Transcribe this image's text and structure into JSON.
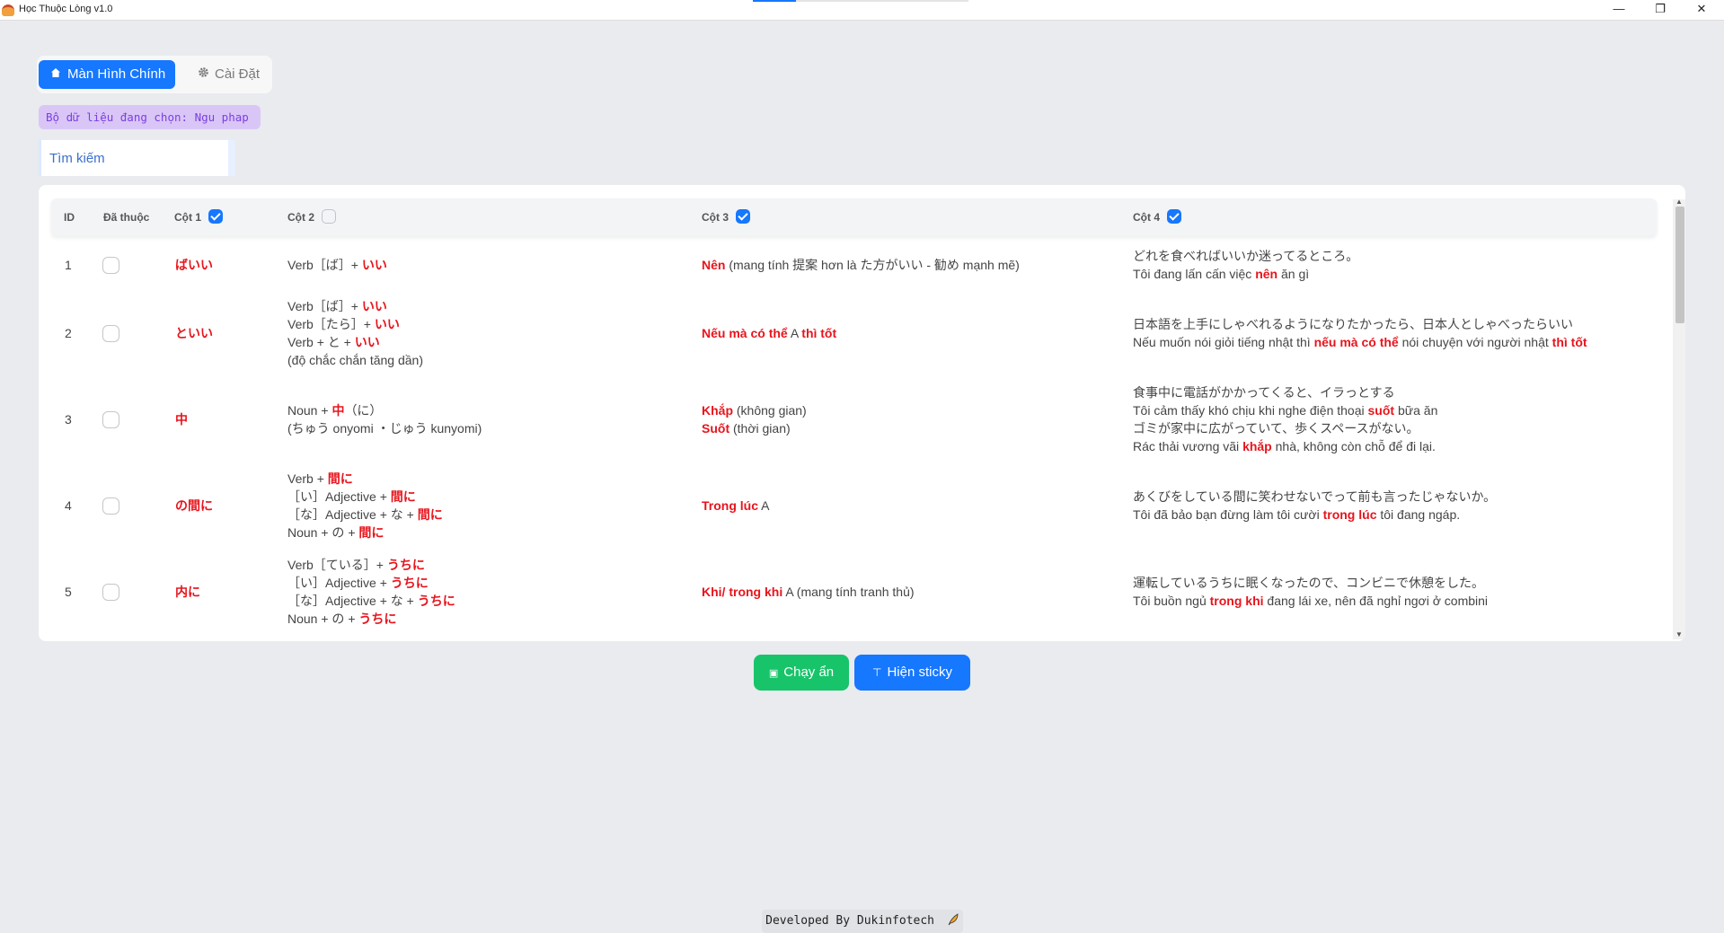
{
  "window": {
    "title": "Học Thuộc Lòng v1.0",
    "minimize": "—",
    "maximize": "❐",
    "close": "✕"
  },
  "tabs": [
    {
      "label": "Màn Hình Chính",
      "icon": "home-icon",
      "active": true
    },
    {
      "label": "Cài Đặt",
      "icon": "gear-icon",
      "active": false
    }
  ],
  "dataset_label": "Bộ dữ liệu đang chọn: Ngu phap",
  "search": {
    "placeholder": "Tìm kiếm",
    "value": ""
  },
  "table": {
    "headers": {
      "id": "ID",
      "learned": "Đã thuộc",
      "col1": "Cột 1",
      "col2": "Cột 2",
      "col3": "Cột 3",
      "col4": "Cột 4"
    },
    "header_checks": {
      "col1": true,
      "col2": false,
      "col3": true,
      "col4": true
    },
    "rows": [
      {
        "id": "1",
        "learned": false,
        "col1": "ばいい",
        "col2": [
          [
            {
              "t": "Verb［ば］+ ",
              "hl": false
            },
            {
              "t": "いい",
              "hl": true
            }
          ]
        ],
        "col3": [
          [
            {
              "t": "Nên",
              "hl": true
            },
            {
              "t": " (mang tính 提案 hơn là た方がいい - 勧め mạnh mẽ)",
              "hl": false
            }
          ]
        ],
        "col4": [
          [
            {
              "t": "どれを食べればいいか迷ってるところ。",
              "hl": false
            }
          ],
          [
            {
              "t": "Tôi đang lấn cấn việc ",
              "hl": false
            },
            {
              "t": "nên",
              "hl": true
            },
            {
              "t": " ăn gì",
              "hl": false
            }
          ]
        ]
      },
      {
        "id": "2",
        "learned": false,
        "col1": "といい",
        "col2": [
          [
            {
              "t": "Verb［ば］+ ",
              "hl": false
            },
            {
              "t": "いい",
              "hl": true
            }
          ],
          [
            {
              "t": "Verb［たら］+ ",
              "hl": false
            },
            {
              "t": "いい",
              "hl": true
            }
          ],
          [
            {
              "t": "Verb + と + ",
              "hl": false
            },
            {
              "t": "いい",
              "hl": true
            }
          ],
          [
            {
              "t": "(độ chắc chắn tăng dần)",
              "hl": false
            }
          ]
        ],
        "col3": [
          [
            {
              "t": "Nếu mà có thể",
              "hl": true
            },
            {
              "t": " A ",
              "hl": false
            },
            {
              "t": "thì tốt",
              "hl": true
            }
          ]
        ],
        "col4": [
          [
            {
              "t": "日本語を上手にしゃべれるようになりたかったら、日本人としゃべったらいい",
              "hl": false
            }
          ],
          [
            {
              "t": "Nếu muốn nói giỏi tiếng nhật thì ",
              "hl": false
            },
            {
              "t": "nếu mà có thể",
              "hl": true
            },
            {
              "t": " nói chuyện với người nhật ",
              "hl": false
            },
            {
              "t": "thì tốt",
              "hl": true
            }
          ]
        ]
      },
      {
        "id": "3",
        "learned": false,
        "col1": "中",
        "col2": [
          [
            {
              "t": "Noun + ",
              "hl": false
            },
            {
              "t": "中",
              "hl": true
            },
            {
              "t": "（に）",
              "hl": false
            }
          ],
          [
            {
              "t": "(ちゅう onyomi ・じゅう kunyomi)",
              "hl": false
            }
          ]
        ],
        "col3": [
          [
            {
              "t": "Khắp",
              "hl": true
            },
            {
              "t": " (không gian)",
              "hl": false
            }
          ],
          [
            {
              "t": "Suốt",
              "hl": true
            },
            {
              "t": " (thời gian)",
              "hl": false
            }
          ]
        ],
        "col4": [
          [
            {
              "t": "食事中に電話がかかってくると、イラっとする",
              "hl": false
            }
          ],
          [
            {
              "t": "Tôi cảm thấy khó chịu khi nghe điện thoại ",
              "hl": false
            },
            {
              "t": "suốt",
              "hl": true
            },
            {
              "t": " bữa ăn",
              "hl": false
            }
          ],
          [
            {
              "t": "ゴミが家中に広がっていて、歩くスペースがない。",
              "hl": false
            }
          ],
          [
            {
              "t": "Rác thải vương vãi ",
              "hl": false
            },
            {
              "t": "khắp",
              "hl": true
            },
            {
              "t": " nhà, không còn chỗ để đi lại.",
              "hl": false
            }
          ]
        ]
      },
      {
        "id": "4",
        "learned": false,
        "col1": "の間に",
        "col2": [
          [
            {
              "t": "Verb + ",
              "hl": false
            },
            {
              "t": "間に",
              "hl": true
            }
          ],
          [
            {
              "t": "［い］Adjective + ",
              "hl": false
            },
            {
              "t": "間に",
              "hl": true
            }
          ],
          [
            {
              "t": "［な］Adjective + な + ",
              "hl": false
            },
            {
              "t": "間に",
              "hl": true
            }
          ],
          [
            {
              "t": "Noun + の + ",
              "hl": false
            },
            {
              "t": "間に",
              "hl": true
            }
          ]
        ],
        "col3": [
          [
            {
              "t": "Trong lúc",
              "hl": true
            },
            {
              "t": " A",
              "hl": false
            }
          ]
        ],
        "col4": [
          [
            {
              "t": "あくびをしている間に笑わせないでって前も言ったじゃないか。",
              "hl": false
            }
          ],
          [
            {
              "t": "Tôi đã bảo bạn đừng làm tôi cười ",
              "hl": false
            },
            {
              "t": "trong lúc",
              "hl": true
            },
            {
              "t": " tôi đang ngáp.",
              "hl": false
            }
          ]
        ]
      },
      {
        "id": "5",
        "learned": false,
        "col1": "内に",
        "col2": [
          [
            {
              "t": "Verb［ている］+ ",
              "hl": false
            },
            {
              "t": "うちに",
              "hl": true
            }
          ],
          [
            {
              "t": "［い］Adjective + ",
              "hl": false
            },
            {
              "t": "うちに",
              "hl": true
            }
          ],
          [
            {
              "t": "［な］Adjective + な + ",
              "hl": false
            },
            {
              "t": "うちに",
              "hl": true
            }
          ],
          [
            {
              "t": "Noun + の + ",
              "hl": false
            },
            {
              "t": "うちに",
              "hl": true
            }
          ]
        ],
        "col3": [
          [
            {
              "t": "Khi/ trong khi",
              "hl": true
            },
            {
              "t": " A (mang tính tranh thủ)",
              "hl": false
            }
          ]
        ],
        "col4": [
          [
            {
              "t": "運転しているうちに眠くなったので、コンビニで休憩をした。",
              "hl": false
            }
          ],
          [
            {
              "t": "Tôi buồn ngủ ",
              "hl": false
            },
            {
              "t": "trong khi",
              "hl": true
            },
            {
              "t": " đang lái xe, nên đã nghỉ ngơi ở combini",
              "hl": false
            }
          ]
        ]
      }
    ]
  },
  "buttons": {
    "run_hidden": {
      "label": "Chạy ẩn",
      "icon": "app-window-icon",
      "color": "#18c46a"
    },
    "show_sticky": {
      "label": "Hiện sticky",
      "icon": "pin-icon",
      "color": "#1677ff"
    }
  },
  "footer": {
    "text": "Developed By Dukinfotech",
    "icon": "feather-icon"
  },
  "colors": {
    "accent": "#1677ff",
    "highlight": "#e8141c",
    "dataset_bg": "#d9c6f7",
    "dataset_text": "#7b3fe0"
  }
}
